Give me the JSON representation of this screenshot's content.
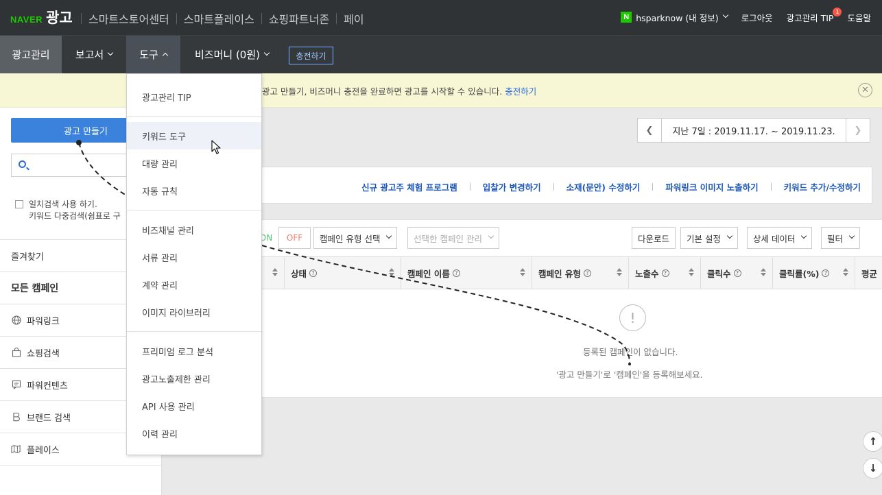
{
  "topbar": {
    "brand": "NAVER",
    "brand_ad": "광고",
    "links": [
      "스마트스토어센터",
      "스마트플레이스",
      "쇼핑파트너존",
      "페이"
    ],
    "user": "hsparknow (내 정보)",
    "logout": "로그아웃",
    "tip": "광고관리 TIP",
    "tip_badge": "1",
    "help": "도움말"
  },
  "nav": {
    "items": [
      "광고관리",
      "보고서",
      "도구",
      "비즈머니 (0원)"
    ],
    "charge_button": "충전하기"
  },
  "notice": {
    "text": "광고 만들기, 비즈머니 충전을 완료하면 광고를 시작할 수 있습니다.",
    "link": "충전하기"
  },
  "sidebar": {
    "create_button": "광고 만들기",
    "search_placeholder": "",
    "exact_label": "일치검색 사용 하기.",
    "multi_label": "키워드 다중검색(쉼표로 구",
    "favorites": "즐겨찾기",
    "all_campaigns": "모든 캠페인",
    "items": [
      "파워링크",
      "쇼핑검색",
      "파워컨텐츠",
      "브랜드 검색",
      "플레이스"
    ]
  },
  "date": {
    "label": "지난 7일 : 2019.11.17. ~ 2019.11.23."
  },
  "promo_links": [
    "신규 광고주 체험 프로그램",
    "입찰가 변경하기",
    "소재(문안) 수정하기",
    "파워링크 이미지 노출하기",
    "키워드 추가/수정하기"
  ],
  "toolbar": {
    "on": "ON",
    "off": "OFF",
    "campaign_type": "캠페인 유형 선택",
    "manage_selected": "선택한 캠페인 관리",
    "download": "다운로드",
    "default_settings": "기본 설정",
    "detail_data": "상세 데이터",
    "filter": "필터"
  },
  "table": {
    "headers": [
      "상태",
      "캠페인 이름",
      "캠페인 유형",
      "노출수",
      "클릭수",
      "클릭률(%)",
      "평균"
    ],
    "empty_1": "등록된 캠페인이 없습니다.",
    "empty_2": "'광고 만들기'로 '캠페인'을 등록해보세요."
  },
  "dropdown": {
    "groups": [
      [
        "광고관리 TIP"
      ],
      [
        "키워드 도구",
        "대량 관리",
        "자동 규칙"
      ],
      [
        "비즈채널 관리",
        "서류 관리",
        "계약 관리",
        "이미지 라이브러리"
      ],
      [
        "프리미엄 로그 분석",
        "광고노출제한 관리",
        "API 사용 관리",
        "이력 관리"
      ]
    ],
    "hovered": "키워드 도구"
  },
  "colors": {
    "topbar": "#2f3335",
    "navbar": "#36393b",
    "accent": "#3b82dc",
    "naver_green": "#1ec800",
    "notice_bg": "#f7f7d5"
  }
}
